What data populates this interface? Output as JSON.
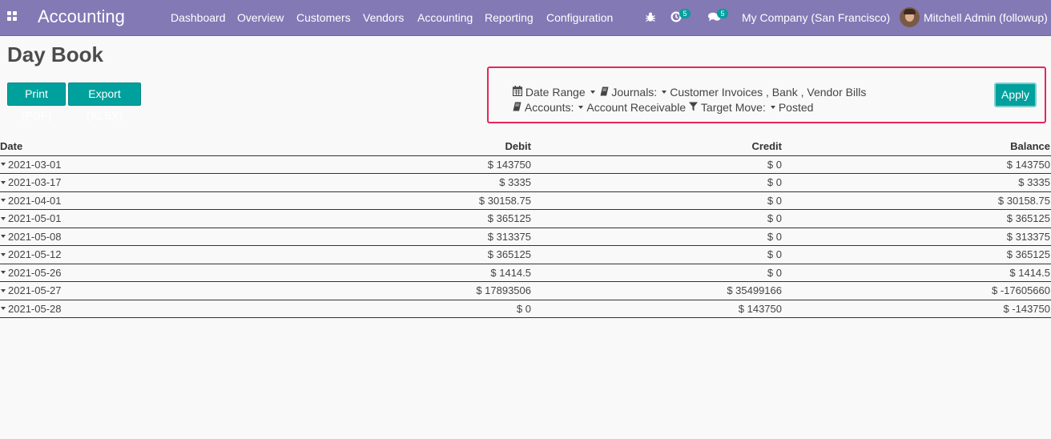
{
  "navbar": {
    "brand": "Accounting",
    "menu": [
      "Dashboard",
      "Overview",
      "Customers",
      "Vendors",
      "Accounting",
      "Reporting",
      "Configuration"
    ],
    "activity_count": "5",
    "messages_count": "5",
    "company": "My Company (San Francisco)",
    "user": "Mitchell Admin (followup)"
  },
  "page": {
    "title": "Day Book",
    "print_label": "Print (PDF)",
    "export_label": "Export (XLSX)"
  },
  "filters": {
    "date_range_label": "Date Range",
    "journals_label": "Journals:",
    "journals_value": "Customer Invoices , Bank , Vendor Bills",
    "accounts_label": "Accounts:",
    "accounts_value": "Account Receivable",
    "target_move_label": "Target Move:",
    "target_move_value": "Posted",
    "apply_label": "Apply"
  },
  "table": {
    "headers": [
      "Date",
      "Debit",
      "Credit",
      "Balance"
    ],
    "rows": [
      [
        "2021-03-01",
        "$ 143750",
        "$ 0",
        "$ 143750"
      ],
      [
        "2021-03-17",
        "$ 3335",
        "$ 0",
        "$ 3335"
      ],
      [
        "2021-04-01",
        "$ 30158.75",
        "$ 0",
        "$ 30158.75"
      ],
      [
        "2021-05-01",
        "$ 365125",
        "$ 0",
        "$ 365125"
      ],
      [
        "2021-05-08",
        "$ 313375",
        "$ 0",
        "$ 313375"
      ],
      [
        "2021-05-12",
        "$ 365125",
        "$ 0",
        "$ 365125"
      ],
      [
        "2021-05-26",
        "$ 1414.5",
        "$ 0",
        "$ 1414.5"
      ],
      [
        "2021-05-27",
        "$ 17893506",
        "$ 35499166",
        "$ -17605660"
      ],
      [
        "2021-05-28",
        "$ 0",
        "$ 143750",
        "$ -143750"
      ]
    ]
  },
  "colors": {
    "navbar": "#8379b5",
    "primary_button": "#00a09d",
    "filter_highlight": "#e8265b"
  },
  "icons": {
    "apps": "apps-grid-icon",
    "debug": "bug-icon",
    "activity": "clock-icon",
    "messages": "chat-icon",
    "date_range": "calendar-icon",
    "journals": "book-icon",
    "accounts": "book-icon",
    "target_move": "filter-icon"
  }
}
